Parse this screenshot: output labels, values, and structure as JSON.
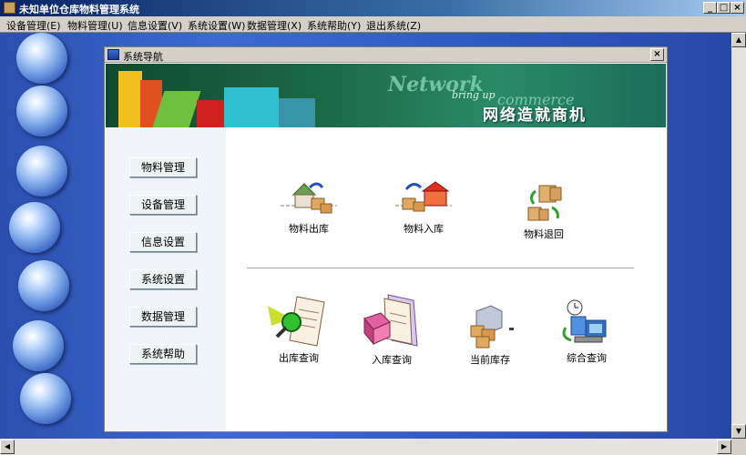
{
  "app": {
    "title": "未知单位仓库物料管理系统",
    "window_buttons": {
      "minimize": "_",
      "maximize": "□",
      "close": "×"
    }
  },
  "menubar": {
    "items": [
      "设备管理(E)",
      "物料管理(U)",
      "信息设置(V)",
      "系统设置(W)",
      "数据管理(X)",
      "系统帮助(Y)",
      "退出系统(Z)"
    ]
  },
  "dialog": {
    "title": "系统导航",
    "close": "×",
    "banner": {
      "network_text": "Network",
      "bring_up_text": "bring up",
      "commerce_text": "commerce",
      "slogan": "网络造就商机"
    },
    "nav": [
      "物料管理",
      "设备管理",
      "信息设置",
      "系统设置",
      "数据管理",
      "系统帮助"
    ],
    "top_icons": [
      {
        "label": "物料出库",
        "icon": "warehouse-out-icon"
      },
      {
        "label": "物料入库",
        "icon": "warehouse-in-icon"
      },
      {
        "label": "物料退回",
        "icon": "material-return-icon"
      }
    ],
    "bottom_icons": [
      {
        "label": "出库查询",
        "icon": "outbound-query-icon"
      },
      {
        "label": "入库查询",
        "icon": "inbound-query-icon"
      },
      {
        "label": "当前库存",
        "icon": "current-stock-icon"
      },
      {
        "label": "综合查询",
        "icon": "general-query-icon"
      }
    ]
  },
  "colors": {
    "desktop": "#3c6ad0",
    "titlebar": "#0a246a",
    "banner": "#1c6a48"
  }
}
